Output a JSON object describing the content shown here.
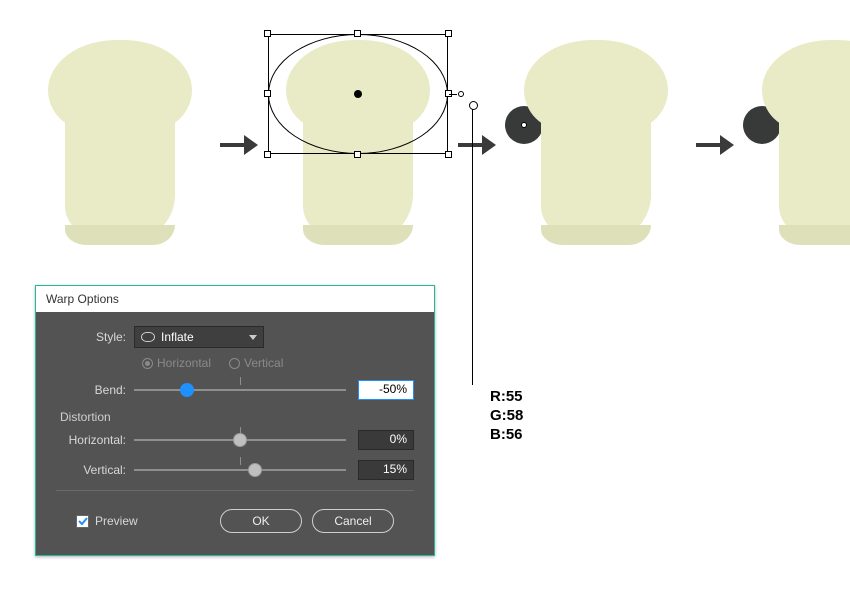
{
  "dialog": {
    "title": "Warp Options",
    "style_label": "Style:",
    "style_value": "Inflate",
    "orient_h": "Horizontal",
    "orient_v": "Vertical",
    "bend_label": "Bend:",
    "bend_value": "-50%",
    "distortion_heading": "Distortion",
    "dh_label": "Horizontal:",
    "dh_value": "0%",
    "dv_label": "Vertical:",
    "dv_value": "15%",
    "preview_label": "Preview",
    "ok": "OK",
    "cancel": "Cancel"
  },
  "annotation": {
    "r": "R:55",
    "g": "G:58",
    "b": "B:56"
  },
  "colors": {
    "shape_fill": "#e9ebc6",
    "ear_fill": "#373a38",
    "dialog_accent": "#23b899"
  }
}
